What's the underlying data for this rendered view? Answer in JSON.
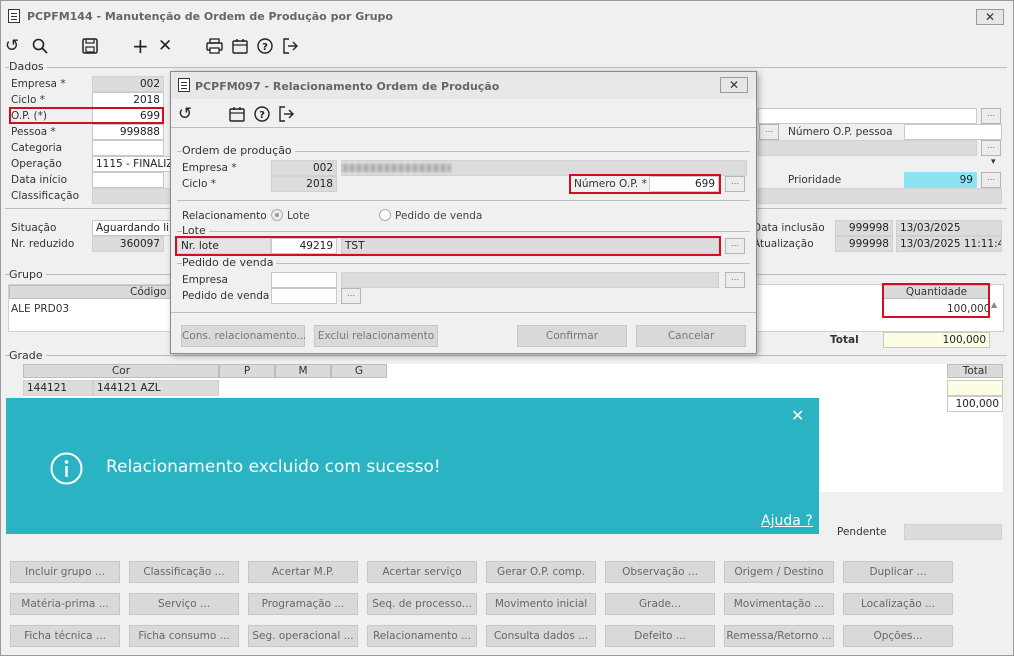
{
  "main": {
    "title": "PCPFM144 - Manutenção de Ordem de Produção por Grupo",
    "close": "✕",
    "toolbar": [
      "refresh-icon",
      "search-icon",
      "save-icon",
      "add-icon",
      "delete-icon",
      "print-icon",
      "calendar-icon",
      "help-icon",
      "exit-icon"
    ],
    "dados_title": "Dados",
    "empresa_label": "Empresa *",
    "empresa_value": "002",
    "ciclo_label": "Ciclo *",
    "ciclo_value": "2018",
    "op_label": "O.P. (*)",
    "op_value": "699",
    "pessoa_label": "Pessoa *",
    "pessoa_value": "999888",
    "categoria_label": "Categoria",
    "operacao_label": "Operação",
    "operacao_value": "1115 - FINALIZA",
    "data_inicio_label": "Data início",
    "classificacao_label": "Classificação",
    "numero_op_pessoa_label": "Número O.P. pessoa",
    "prioridade_label": "Prioridade",
    "prioridade_value": "99",
    "situacao_label": "Situação",
    "situacao_value": "Aguardando libe",
    "nr_reduzido_label": "Nr. reduzido",
    "nr_reduzido_value": "360097",
    "data_inclusao_label": "Data inclusão",
    "data_inclusao_user": "999998",
    "data_inclusao_value": "13/03/2025",
    "atualizacao_label": "Atualização",
    "atualizacao_user": "999998",
    "atualizacao_value": "13/03/2025 11:11:44",
    "grupo_title": "Grupo",
    "codigo_header": "Código",
    "quantidade_header": "Quantidade",
    "grupo_row_codigo": "ALE PRD03",
    "grupo_row_quantidade": "100,000",
    "total_label": "Total",
    "total_value": "100,000",
    "grade_title": "Grade",
    "cor_header": "Cor",
    "p_header": "P",
    "m_header": "M",
    "g_header": "G",
    "total_header": "Total",
    "grade_row_code": "144121",
    "grade_row_cor": "144121 AZL",
    "grade_total_value": "100,000",
    "pendente_label": "Pendente"
  },
  "buttons": [
    [
      "Incluir grupo ...",
      "Classificação ...",
      "Acertar M.P.",
      "Acertar serviço",
      "Gerar O.P. comp.",
      "Observação ...",
      "Origem / Destino",
      "Duplicar ..."
    ],
    [
      "Matéria-prima ...",
      "Serviço ...",
      "Programação ...",
      "Seq. de processo...",
      "Movimento inicial",
      "Grade...",
      "Movimentação ...",
      "Localização ..."
    ],
    [
      "Ficha técnica ...",
      "Ficha consumo ...",
      "Seg. operacional ...",
      "Relacionamento ...",
      "Consulta dados ...",
      "Defeito ...",
      "Remessa/Retorno ...",
      "Opções..."
    ]
  ],
  "dialog": {
    "title": "PCPFM097 - Relacionamento Ordem de Produção",
    "close": "✕",
    "toolbar": [
      "refresh-icon",
      "calendar-icon",
      "help-icon",
      "exit-icon"
    ],
    "ordem_title": "Ordem de produção",
    "empresa_label": "Empresa *",
    "empresa_value": "002",
    "ciclo_label": "Ciclo *",
    "ciclo_value": "2018",
    "numero_op_label": "Número O.P. *",
    "numero_op_value": "699",
    "relacionamento_label": "Relacionamento",
    "radio_lote": "Lote",
    "radio_pedido": "Pedido de venda",
    "lote_title": "Lote",
    "nr_lote_label": "Nr. lote",
    "nr_lote_value": "49219",
    "nr_lote_desc": "TST",
    "pedido_title": "Pedido de venda",
    "pv_empresa_label": "Empresa",
    "pv_pedido_label": "Pedido de venda",
    "btn_cons": "Cons. relacionamento...",
    "btn_exclui": "Exclui relacionamento",
    "btn_confirmar": "Confirmar",
    "btn_cancelar": "Cancelar"
  },
  "toast": {
    "message": "Relacionamento excluido com sucesso!",
    "help": "Ajuda ?",
    "icon": "info-icon",
    "close": "✕",
    "color": "#2ab3c2"
  }
}
